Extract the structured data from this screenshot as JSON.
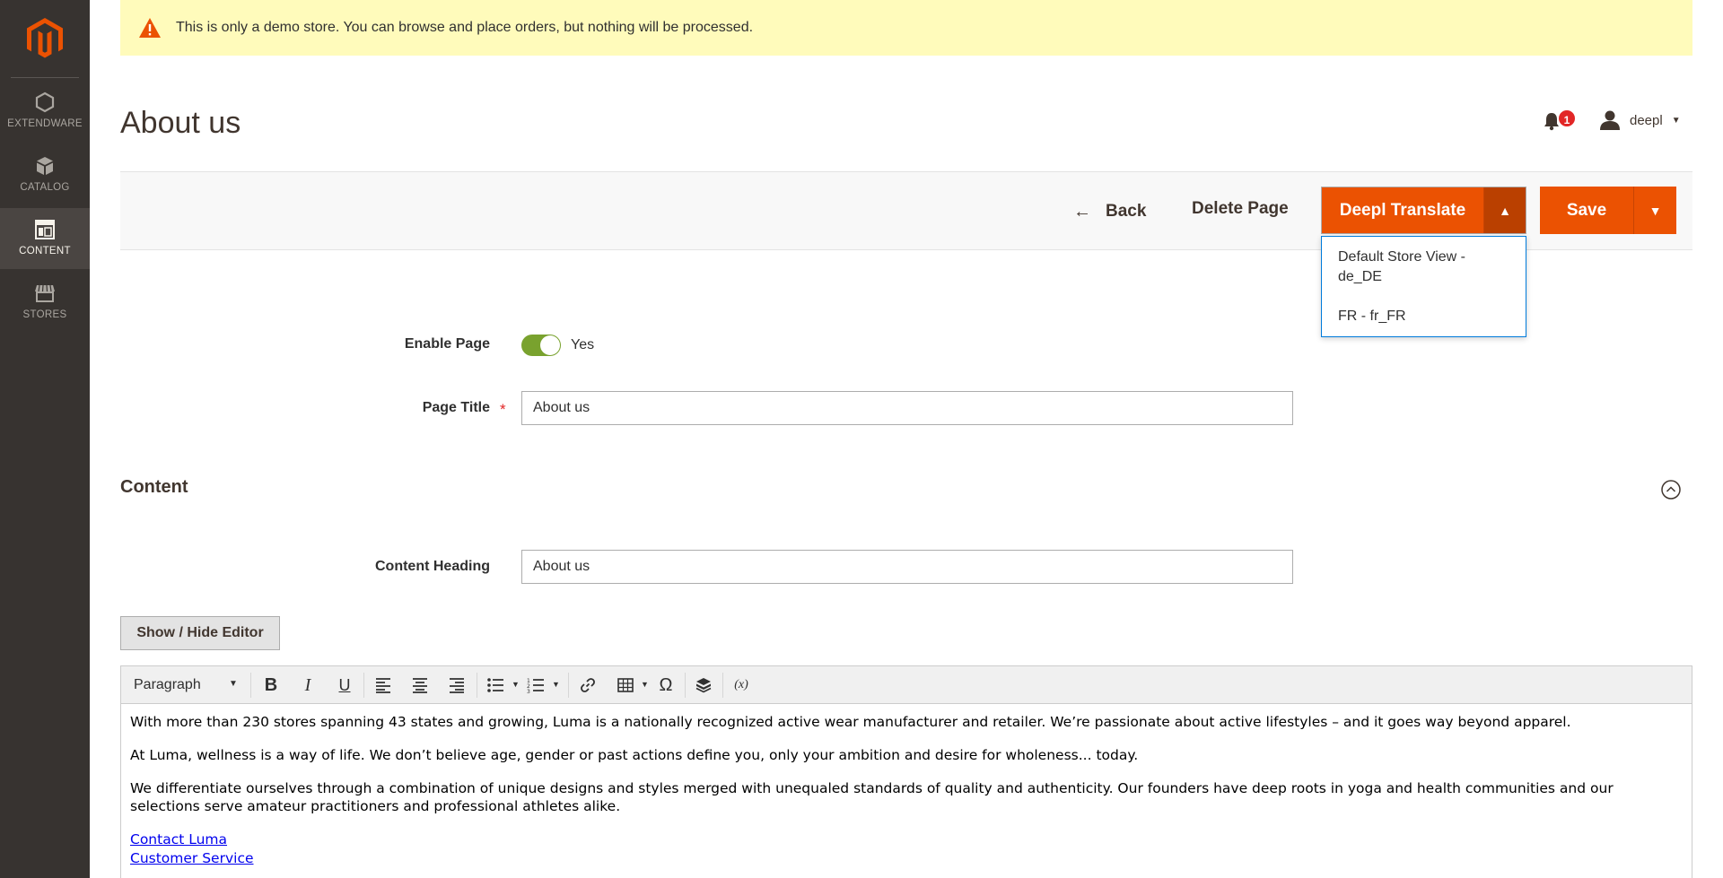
{
  "sidebar": {
    "logo": "magento-logo",
    "items": [
      {
        "label": "EXTENDWARE",
        "icon": "hexagon-icon"
      },
      {
        "label": "CATALOG",
        "icon": "box-icon"
      },
      {
        "label": "CONTENT",
        "icon": "layout-icon",
        "active": true
      },
      {
        "label": "STORES",
        "icon": "storefront-icon"
      }
    ]
  },
  "notice": {
    "text": "This is only a demo store. You can browse and place orders, but nothing will be processed."
  },
  "header": {
    "title": "About us",
    "notifications_count": "1",
    "user_name": "deepl"
  },
  "actions": {
    "back_label": "Back",
    "delete_label": "Delete Page",
    "deepl_label": "Deepl Translate",
    "save_label": "Save",
    "deepl_options": [
      "Default Store View - de_DE",
      "FR - fr_FR"
    ]
  },
  "form": {
    "enable_label": "Enable Page",
    "enable_value": "Yes",
    "enabled": true,
    "title_label": "Page Title",
    "title_value": "About us"
  },
  "content_section": {
    "title": "Content",
    "heading_label": "Content Heading",
    "heading_value": "About us",
    "show_hide_label": "Show / Hide Editor"
  },
  "editor": {
    "format_select": "Paragraph",
    "paragraphs": [
      "With more than 230 stores spanning 43 states and growing, Luma is a nationally recognized active wear manufacturer and retailer. We’re passionate about active lifestyles – and it goes way beyond apparel.",
      "At Luma, wellness is a way of life. We don’t believe age, gender or past actions define you, only your ambition and desire for wholeness... today.",
      "We differentiate ourselves through a combination of unique designs and styles merged with unequaled standards of quality and authenticity. Our founders have deep roots in yoga and health communities and our selections serve amateur practitioners and professional athletes alike."
    ],
    "links": [
      "Contact Luma",
      "Customer Service"
    ]
  },
  "colors": {
    "sidebar": "#373330",
    "accent": "#eb5202",
    "notice_bg": "#fffbbb",
    "toggle_on": "#79a22e"
  }
}
